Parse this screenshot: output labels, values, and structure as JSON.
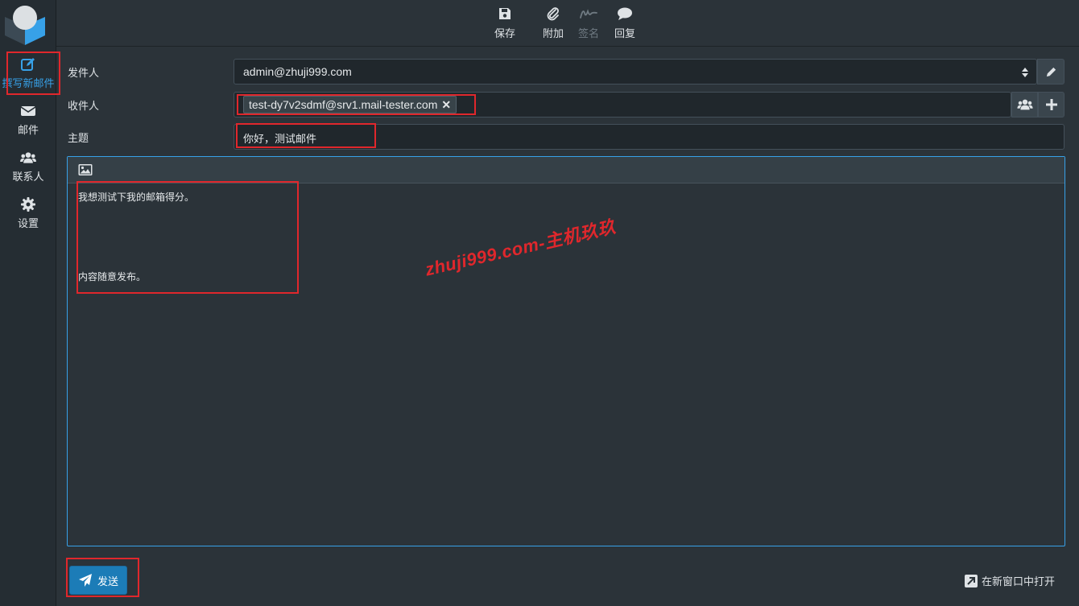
{
  "sidebar": {
    "items": [
      {
        "label": "撰写新邮件",
        "icon": "compose-icon",
        "active": true
      },
      {
        "label": "邮件",
        "icon": "envelope-icon"
      },
      {
        "label": "联系人",
        "icon": "users-icon"
      },
      {
        "label": "设置",
        "icon": "gear-icon"
      }
    ]
  },
  "toolbar": {
    "save": "保存",
    "attach": "附加",
    "signature": "签名",
    "reply": "回复"
  },
  "form": {
    "from_label": "发件人",
    "from_value": "admin@zhuji999.com",
    "to_label": "收件人",
    "recipient": "test-dy7v2sdmf@srv1.mail-tester.com",
    "remove_symbol": "✕",
    "subject_label": "主题",
    "subject_value": "你好，测试邮件"
  },
  "editor": {
    "line1": "我想测试下我的邮箱得分。",
    "line2": "内容随意发布。"
  },
  "watermark": "zhuji999.com-主机玖玖",
  "footer": {
    "send": "发送",
    "open_new_window": "在新窗口中打开"
  },
  "colors": {
    "accent": "#37a1e8",
    "send_button": "#1c7cb7",
    "highlight": "#e0272c"
  }
}
